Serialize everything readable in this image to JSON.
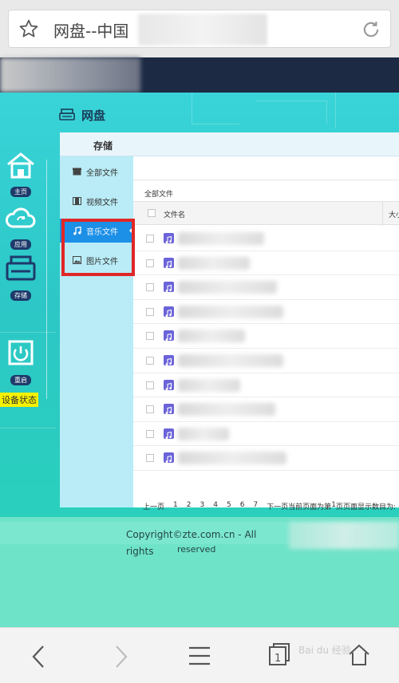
{
  "browser": {
    "url_text": "网盘--中国"
  },
  "page": {
    "heading": "网盘"
  },
  "side_nav": {
    "items": [
      {
        "label": "主页",
        "icon": "home-icon"
      },
      {
        "label": "应用",
        "icon": "cloud-sync-icon"
      },
      {
        "label": "存储",
        "icon": "storage-icon"
      },
      {
        "label": "重启",
        "icon": "power-icon"
      }
    ],
    "device_status": "设备状态"
  },
  "panel": {
    "title": "存储",
    "menu": [
      {
        "label": "全部文件",
        "icon": "box-icon",
        "active": false
      },
      {
        "label": "视频文件",
        "icon": "film-icon",
        "active": false
      },
      {
        "label": "音乐文件",
        "icon": "music-icon",
        "active": true
      },
      {
        "label": "图片文件",
        "icon": "image-icon",
        "active": false
      }
    ],
    "breadcrumb": "全部文件",
    "table": {
      "col_name": "文件名",
      "col_size": "大小"
    },
    "pagination": {
      "prev": "上一页",
      "pages": [
        "1",
        "2",
        "3",
        "4",
        "5",
        "6",
        "7"
      ],
      "next": "下一页",
      "status_prefix": "当前页面为第",
      "current_page": "1",
      "status_suffix": "页",
      "per_page": "页面显示数目为:"
    }
  },
  "footer": {
    "copyright_line1": "Copyright©zte.com.cn - All rights",
    "copyright_line2": "reserved"
  },
  "watermark": "Bai du 经验",
  "colors": {
    "teal": "#2cc7c6",
    "active_blue": "#1c8fe6",
    "highlight_red": "#e02727",
    "music_icon": "#6b63d9"
  }
}
